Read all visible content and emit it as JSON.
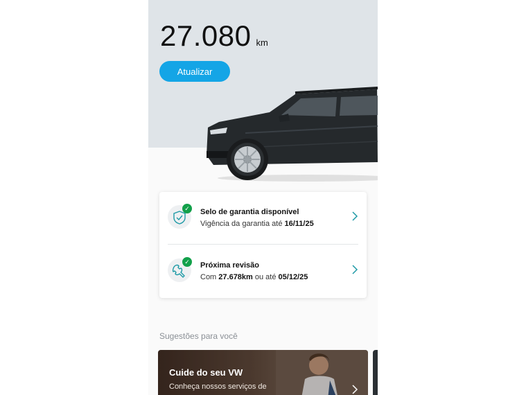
{
  "odometer": {
    "value": "27.080",
    "unit": "km"
  },
  "actions": {
    "update_label": "Atualizar"
  },
  "status_card": {
    "warranty": {
      "title": "Selo de garantia disponível",
      "sub_prefix": "Vigência da garantia até ",
      "sub_date": "16/11/25"
    },
    "revision": {
      "title": "Próxima revisão",
      "sub_prefix": "Com ",
      "sub_km": "27.678km",
      "sub_middle": " ou até ",
      "sub_date": "05/12/25"
    }
  },
  "suggestions": {
    "heading": "Sugestões para você",
    "promo_title": "Cuide do seu VW",
    "promo_text": "Conheça nossos serviços de"
  },
  "colors": {
    "accent": "#14a5e6",
    "hero_bg": "#dfe4e8",
    "check_green": "#12a04a",
    "icon_teal": "#1e9aa6"
  }
}
